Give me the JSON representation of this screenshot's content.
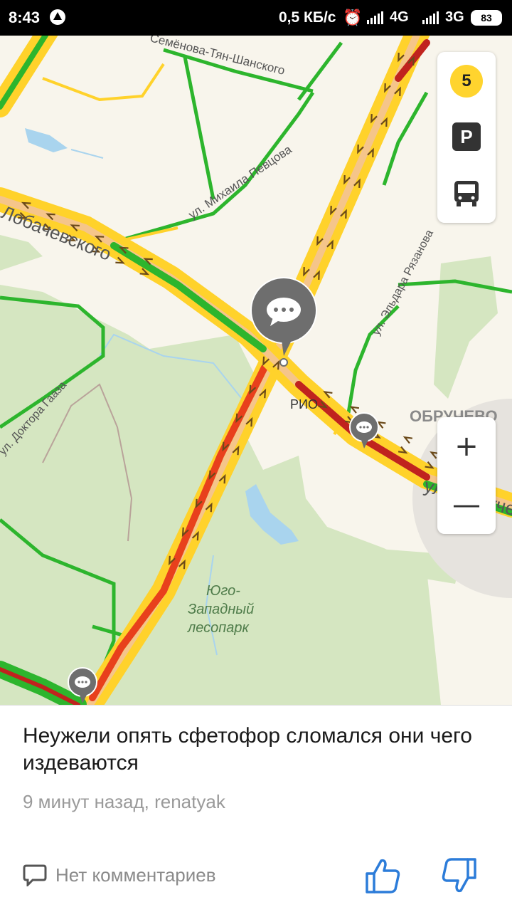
{
  "status_bar": {
    "time": "8:43",
    "network_speed": "0,5 КБ/с",
    "network_1": "4G",
    "network_2": "3G",
    "battery": "83",
    "icons": [
      "navigation-app-icon",
      "alarm-icon",
      "signal-icon",
      "signal-icon",
      "battery-icon"
    ]
  },
  "map": {
    "street_labels": {
      "semenova": "Семёнова-Тян-Шанского",
      "levtsova": "ул. Михаила Певцова",
      "lobachevskogo": "Лобачевского",
      "ryazanova": "ул. Эльдара Рязанова",
      "gaaza": "ул. Доктора Гааза",
      "obrucheva": "ул. Обручева"
    },
    "place_labels": {
      "rio": "РИО",
      "district": "ОБРУЧЕВО",
      "park_line1": "Юго-",
      "park_line2": "Западный",
      "park_line3": "лесопарк"
    },
    "traffic_colors": {
      "free": "#2db52d",
      "moderate": "#ffd22b",
      "heavy": "#e8401c",
      "jam": "#c0231e"
    },
    "map_colors": {
      "land": "#f8f5ec",
      "park": "#d5e6c1",
      "water": "#a9d4ee"
    }
  },
  "layers": {
    "traffic_level": "5",
    "parking_label": "P",
    "icons": [
      "traffic-level-icon",
      "parking-icon",
      "transit-bus-icon"
    ]
  },
  "zoom": {
    "plus": "+",
    "minus": "—"
  },
  "event": {
    "title": "Неужели опять сфетофор сломался они чего издеваются",
    "meta": "9 минут назад, renatyak",
    "comments": "Нет комментариев"
  }
}
